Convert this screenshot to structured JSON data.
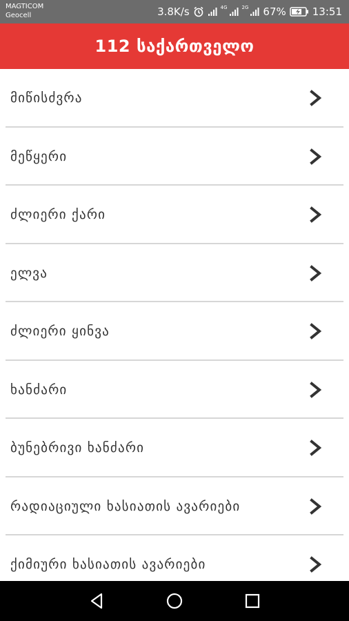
{
  "status_bar": {
    "carrier_primary": "MAGTICOM",
    "carrier_secondary": "Geocell",
    "net_speed": "3.8K/s",
    "sim1_label": "4G",
    "sim2_label": "2G",
    "battery_percent": "67%",
    "time": "13:51",
    "icons": [
      "alarm-icon",
      "signal-icon",
      "signal-icon",
      "battery-charging-icon"
    ]
  },
  "app_bar": {
    "title": "112 საქართველო",
    "color": "#e53935"
  },
  "menu": {
    "items": [
      {
        "label": "მიწისძვრა"
      },
      {
        "label": "მეწყერი"
      },
      {
        "label": "ძლიერი ქარი"
      },
      {
        "label": "ელვა"
      },
      {
        "label": "ძლიერი ყინვა"
      },
      {
        "label": "ხანძარი"
      },
      {
        "label": "ბუნებრივი ხანძარი"
      },
      {
        "label": "რადიაციული ხასიათის ავარიები"
      },
      {
        "label": "ქიმიური ხასიათის ავარიები"
      }
    ],
    "chevron_icon": "chevron-right-icon"
  },
  "nav_bar": {
    "icons": [
      "back-icon",
      "home-icon",
      "recents-icon"
    ]
  }
}
